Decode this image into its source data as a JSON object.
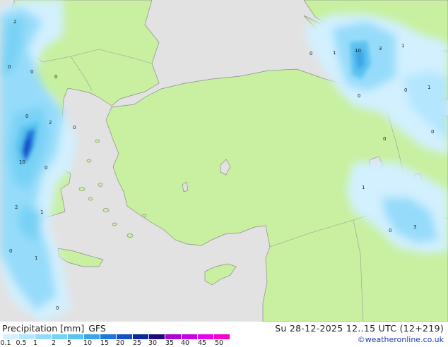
{
  "map": {
    "colors": {
      "sea": "#e2e2e2",
      "land": "#c8f0a0",
      "border": "#999999",
      "coast": "#8c8c8c"
    },
    "precip_labels": [
      {
        "text": "2"
      },
      {
        "text": "0"
      },
      {
        "text": "0"
      },
      {
        "text": "0"
      },
      {
        "text": "0"
      },
      {
        "text": "2"
      },
      {
        "text": "0"
      },
      {
        "text": "10"
      },
      {
        "text": "0"
      },
      {
        "text": "2"
      },
      {
        "text": "1"
      },
      {
        "text": "0"
      },
      {
        "text": "1"
      },
      {
        "text": "0"
      },
      {
        "text": "0"
      },
      {
        "text": "1"
      },
      {
        "text": "10"
      },
      {
        "text": "3"
      },
      {
        "text": "1"
      },
      {
        "text": "0"
      },
      {
        "text": "0"
      },
      {
        "text": "1"
      },
      {
        "text": "0"
      },
      {
        "text": "0"
      },
      {
        "text": "1"
      },
      {
        "text": "0"
      },
      {
        "text": "3"
      }
    ]
  },
  "footer": {
    "title": "Precipitation [mm]",
    "model": "GFS",
    "time": "Su 28-12-2025 12..15 UTC (12+219)",
    "credit": "©weatheronline.co.uk"
  },
  "legend": {
    "ticks": [
      "0.1",
      "0.5",
      "1",
      "2",
      "5",
      "10",
      "15",
      "20",
      "25",
      "30",
      "35",
      "40",
      "45",
      "50"
    ],
    "colors": [
      "#d2f0ff",
      "#b4e6ff",
      "#96dcfa",
      "#78d2f5",
      "#5ac3f0",
      "#3ca5e6",
      "#1e78dc",
      "#1450c8",
      "#0a2896",
      "#1e0a78",
      "#aa00d2",
      "#c800e6",
      "#e600f0",
      "#f500c8"
    ]
  }
}
